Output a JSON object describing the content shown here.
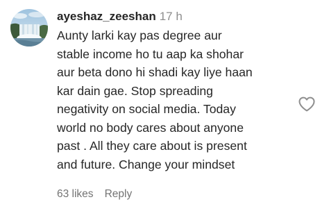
{
  "comment": {
    "username": "ayeshaz_zeeshan",
    "timestamp": "17 h",
    "text": "Aunty larki kay pas degree aur\nstable income ho tu aap ka shohar\naur beta dono hi shadi kay liye haan\nkar dain gae. Stop spreading\nnegativity on social media. Today\nworld no body cares about anyone\npast . All they care about is present\nand future. Change your mindset",
    "likes": "63 likes",
    "reply_label": "Reply"
  },
  "icons": {
    "like": "heart-outline-icon",
    "avatar": "profile-picture-waterfall"
  },
  "colors": {
    "text_primary": "#262626",
    "text_secondary": "#737373",
    "timestamp": "#8e8e8e",
    "icon_stroke": "#8e8e8e"
  }
}
